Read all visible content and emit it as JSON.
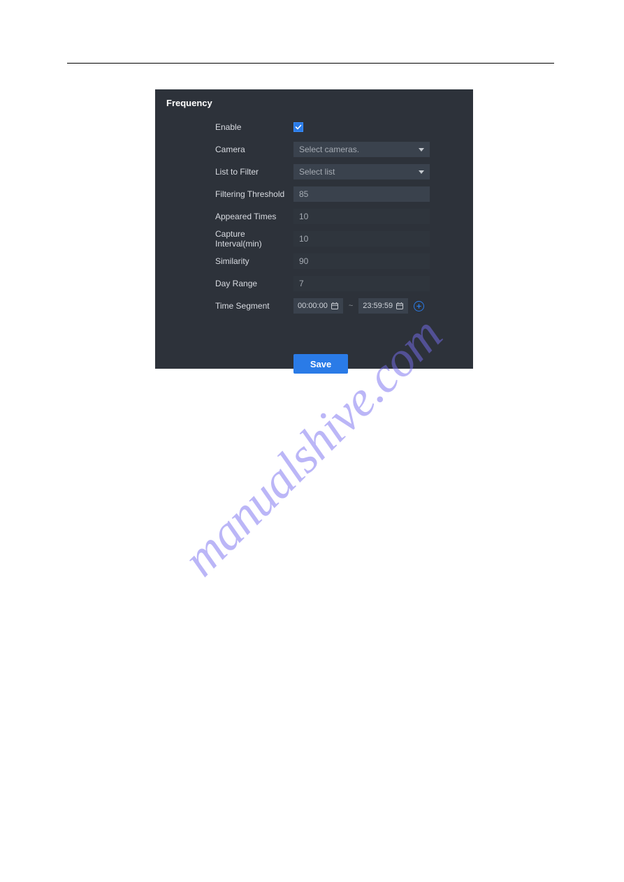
{
  "panel_title": "Frequency",
  "labels": {
    "enable": "Enable",
    "camera": "Camera",
    "list_to_filter": "List to Filter",
    "filtering_threshold": "Filtering Threshold",
    "appeared_times": "Appeared Times",
    "capture_interval": "Capture Interval(min)",
    "similarity": "Similarity",
    "day_range": "Day Range",
    "time_segment": "Time Segment"
  },
  "values": {
    "enable_checked": true,
    "camera_placeholder": "Select cameras.",
    "list_placeholder": "Select list",
    "filtering_threshold": "85",
    "appeared_times": "10",
    "capture_interval": "10",
    "similarity": "90",
    "day_range": "7",
    "time_start": "00:00:00",
    "time_end": "23:59:59"
  },
  "buttons": {
    "save": "Save"
  },
  "watermark": "manualshive.com",
  "colors": {
    "panel_bg": "#2d323a",
    "input_bg": "#3a424d",
    "accent": "#2a7be7"
  }
}
